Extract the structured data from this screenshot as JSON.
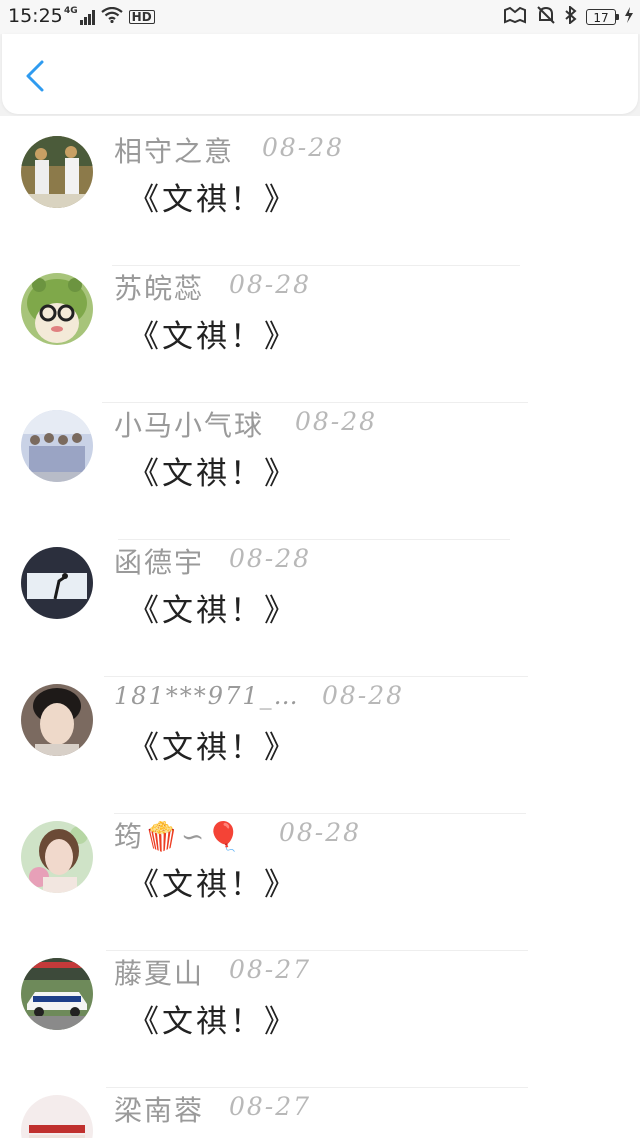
{
  "status_bar": {
    "time": "15:25",
    "network": "4G",
    "hd": "HD",
    "battery": "17"
  },
  "comments": [
    {
      "nickname": "相守之意",
      "date": "08-28",
      "content": "《文祺！》"
    },
    {
      "nickname": "苏皖蕊",
      "date": "08-28",
      "content": "《文祺！》"
    },
    {
      "nickname": "小马小气球",
      "date": "08-28",
      "content": "《文祺！》"
    },
    {
      "nickname": "函德宇",
      "date": "08-28",
      "content": "《文祺！》"
    },
    {
      "nickname": "181***971_…",
      "date": "08-28",
      "content": "《文祺！》"
    },
    {
      "nickname": "筠🍿∽🎈",
      "date": "08-28",
      "content": "《文祺！》"
    },
    {
      "nickname": "藤夏山",
      "date": "08-27",
      "content": "《文祺！》"
    },
    {
      "nickname": "梁南蓉",
      "date": "08-27",
      "content": ""
    }
  ]
}
